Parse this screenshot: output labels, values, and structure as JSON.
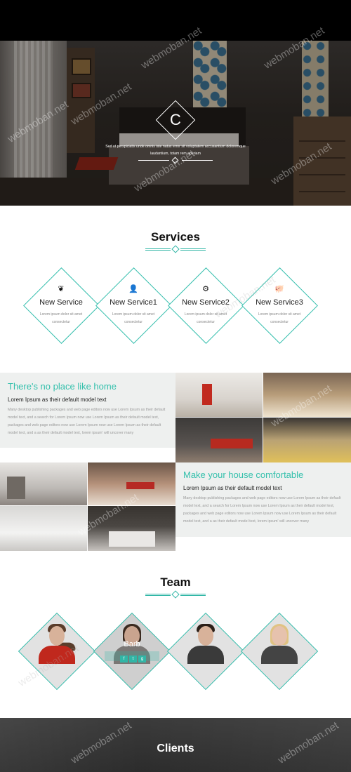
{
  "hero": {
    "logo_letter": "C",
    "text": "Sed ut perspiciatis unde omnis iste natus error sit voluptatem accusantium doloremque laudantium, totam rem aperiam"
  },
  "services": {
    "title": "Services",
    "items": [
      {
        "icon": "leaf-icon",
        "glyph": "❦",
        "label": "New Service",
        "desc": "Lorem ipsum dolor sit amet consectetur"
      },
      {
        "icon": "user-icon",
        "glyph": "👤",
        "label": "New Service1",
        "desc": "Lorem ipsum dolor sit amet consectetur"
      },
      {
        "icon": "gear-icon",
        "glyph": "⚙",
        "label": "New Service2",
        "desc": "Lorem ipsum dolor sit amet consectetur"
      },
      {
        "icon": "piggy-bank-icon",
        "glyph": "🐖",
        "label": "New Service3",
        "desc": "Lorem ipsum dolor sit amet consectetur"
      }
    ]
  },
  "about": [
    {
      "title": "There's no place like home",
      "subtitle": "Lorem Ipsum as their default model text",
      "body": "Many desktop publishing packages and web page editors now use Lorem Ipsum as their default model text, and a search for Lorem Ipsum now use Lorem Ipsum as their default model text, packages and web page editors now use Lorem Ipsum now use Lorem Ipsum as their default model text, and a as their default model text, lorem ipsum' will uncover many"
    },
    {
      "title": "Make your house comfortable",
      "subtitle": "Lorem Ipsum as their default model text",
      "body": "Many desktop publishing packages and web page editors now use Lorem Ipsum as their default model text, and a search for Lorem Ipsum now use Lorem Ipsum as their default model text, packages and web page editors now use Lorem Ipsum now use Lorem Ipsum as their default model text, and a as their default model text, lorem ipsum' will uncover many"
    }
  ],
  "team": {
    "title": "Team",
    "members": [
      {
        "name": "",
        "hair": "#5a3d2b",
        "shirt": "#c0281d"
      },
      {
        "name": "Barb",
        "hair": "#3a2a20",
        "shirt": "#7a7775",
        "socials": [
          "f",
          "t",
          "g"
        ]
      },
      {
        "name": "",
        "hair": "#2b1f18",
        "shirt": "#3a3a3a"
      },
      {
        "name": "",
        "hair": "#e0c383",
        "shirt": "#444444"
      }
    ]
  },
  "clients": {
    "title": "Clients"
  },
  "watermark": "webmoban.net",
  "colors": {
    "accent": "#31b6a6",
    "about_bg": "#eef0ef"
  }
}
